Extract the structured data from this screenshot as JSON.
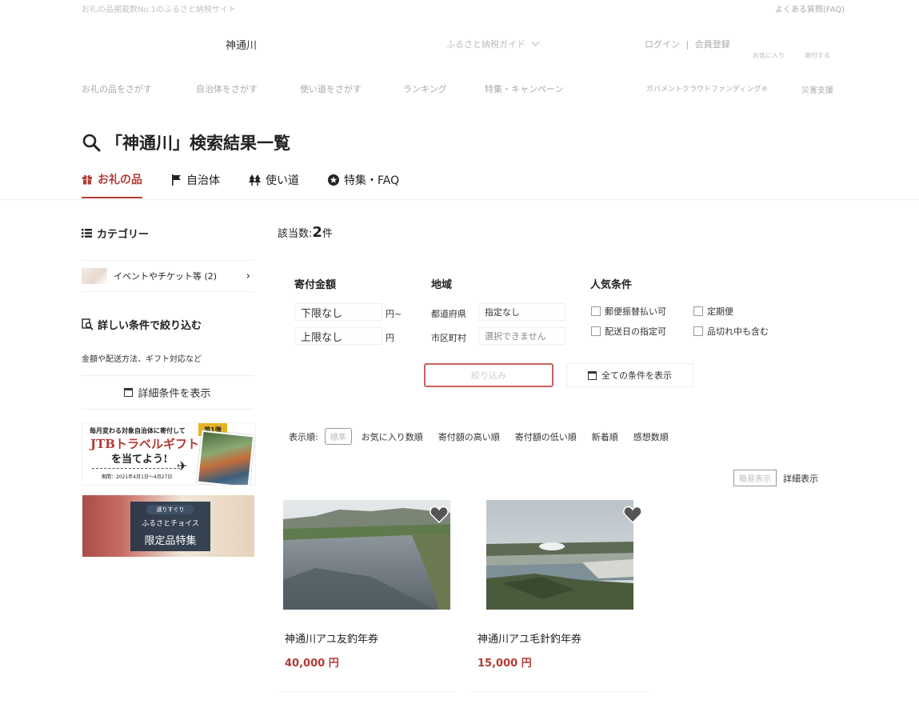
{
  "header": {
    "tagline": "お礼の品掲載数No.1のふるさと納税サイト",
    "faq": "よくある質問(FAQ)",
    "search_value": "神通川",
    "guide": "ふるさと納税ガイド",
    "login": "ログイン",
    "register": "会員登録",
    "favorites": "お気に入り",
    "donate": "寄付する"
  },
  "nav": [
    "お礼の品をさがす",
    "自治体をさがす",
    "使い道をさがす",
    "ランキング",
    "特集・キャンペーン",
    "ガバメントクラウドファンディング®",
    "災害支援"
  ],
  "page": {
    "title": "「神通川」検索結果一覧"
  },
  "tabs": [
    {
      "label": "お礼の品",
      "icon": "gift-icon"
    },
    {
      "label": "自治体",
      "icon": "flag-icon"
    },
    {
      "label": "使い道",
      "icon": "trees-icon"
    },
    {
      "label": "特集・FAQ",
      "icon": "star-circle-icon"
    }
  ],
  "sidebar": {
    "category_heading": "カテゴリー",
    "category_item": "イベントやチケット等 (2)",
    "refine_heading": "詳しい条件で絞り込む",
    "refine_sub": "金額や配送方法、ギフト対応など",
    "detail_button": "詳細条件を表示",
    "banner1": {
      "line1": "毎月変わる対象自治体に寄付して",
      "brand": "JTBトラベルギフト",
      "line3": "を当てよう!",
      "period": "期間：2021年4月1日〜4月27日",
      "badge": "第1弾"
    },
    "banner2": {
      "line1": "選りすぐり",
      "line2": "ふるさとチョイス",
      "line3": "限定品特集"
    }
  },
  "results": {
    "count_label": "該当数:",
    "count": "2",
    "count_unit": "件"
  },
  "filters": {
    "amount": {
      "heading": "寄付金額",
      "min": "下限なし",
      "min_unit": "円~",
      "max": "上限なし",
      "max_unit": "円"
    },
    "region": {
      "heading": "地域",
      "pref_label": "都道府県",
      "pref_value": "指定なし",
      "city_label": "市区町村",
      "city_value": "選択できません"
    },
    "popular": {
      "heading": "人気条件",
      "options": [
        "郵便振替払い可",
        "定期便",
        "配送日の指定可",
        "品切れ中も含む"
      ]
    },
    "narrow_button": "絞り込み",
    "all_button": "全ての条件を表示"
  },
  "sort": {
    "label": "表示順:",
    "selected": "標準",
    "options": [
      "お気に入り数順",
      "寄付額の高い順",
      "寄付額の低い順",
      "新着順",
      "感想数順"
    ]
  },
  "view": {
    "simple": "簡易表示",
    "detail": "詳細表示"
  },
  "products": [
    {
      "name": "神通川アユ友釣年券",
      "price": "40,000 円"
    },
    {
      "name": "神通川アユ毛針釣年券",
      "price": "15,000 円"
    }
  ],
  "colors": {
    "accent": "#b33a35"
  }
}
